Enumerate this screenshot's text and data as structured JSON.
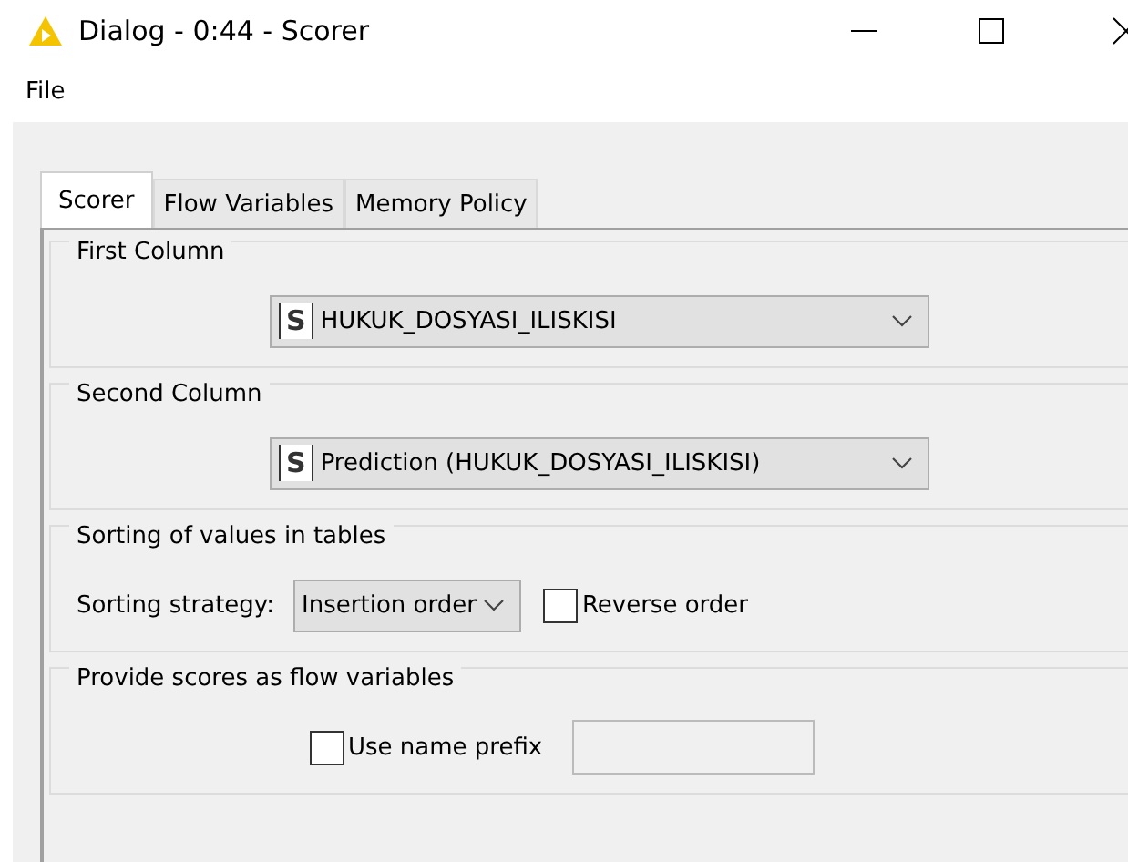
{
  "window": {
    "title": "Dialog - 0:44 - Scorer"
  },
  "menu": [
    "File"
  ],
  "tabs": [
    {
      "label": "Scorer",
      "selected": true
    },
    {
      "label": "Flow Variables",
      "selected": false
    },
    {
      "label": "Memory Policy",
      "selected": false
    }
  ],
  "first_column": {
    "legend": "First Column",
    "type_badge": "S",
    "value": "HUKUK_DOSYASI_ILISKISI"
  },
  "second_column": {
    "legend": "Second Column",
    "type_badge": "S",
    "value": "Prediction (HUKUK_DOSYASI_ILISKISI)"
  },
  "sorting": {
    "legend": "Sorting of values in tables",
    "label": "Sorting strategy:",
    "value": "Insertion order",
    "reverse": {
      "label": "Reverse order",
      "checked": false
    }
  },
  "flow_variables": {
    "legend": "Provide scores as flow variables",
    "prefix": {
      "label": "Use name prefix",
      "checked": false
    }
  }
}
